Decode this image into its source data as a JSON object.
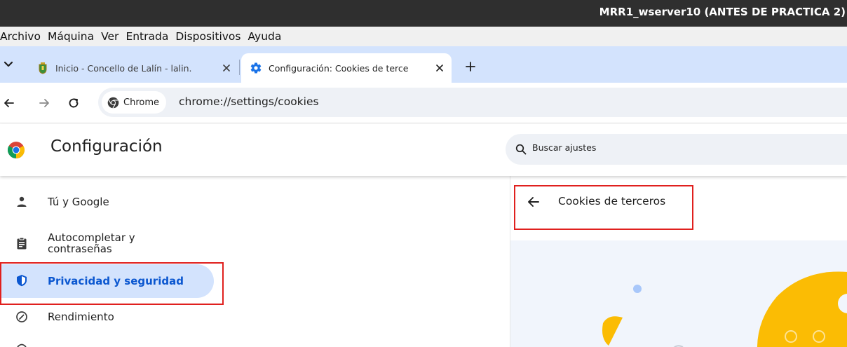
{
  "window": {
    "title": "MRR1_wserver10 (ANTES DE PRACTICA 2)",
    "menu": [
      "Archivo",
      "Máquina",
      "Ver",
      "Entrada",
      "Dispositivos",
      "Ayuda"
    ]
  },
  "tabs": [
    {
      "label": "Inicio - Concello de Lalín - lalin.",
      "favicon": "town-crest-icon",
      "active": false
    },
    {
      "label": "Configuración: Cookies de terce",
      "favicon": "gear-icon",
      "active": true
    }
  ],
  "toolbar": {
    "chip_label": "Chrome",
    "url": "chrome://settings/cookies"
  },
  "settings": {
    "title": "Configuración",
    "search_placeholder": "Buscar ajustes"
  },
  "sidebar": {
    "items": [
      {
        "label": "Tú y Google",
        "icon": "person-icon"
      },
      {
        "label": "Autocompletar y contraseñas",
        "line1": "Autocompletar y",
        "line2": "contraseñas",
        "icon": "clipboard-icon"
      },
      {
        "label": "Privacidad y seguridad",
        "icon": "shield-icon",
        "selected": true
      },
      {
        "label": "Rendimiento",
        "icon": "speedometer-icon"
      }
    ]
  },
  "main": {
    "subpage_title": "Cookies de terceros"
  },
  "colors": {
    "accent": "#0b57d0",
    "tab_strip": "#d3e3fd",
    "highlight_box": "#e0201e",
    "illustration_yellow": "#fbbc04"
  }
}
